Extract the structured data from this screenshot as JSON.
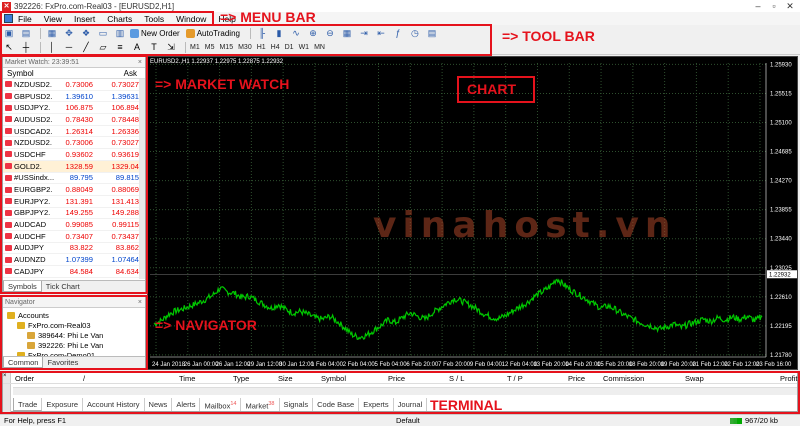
{
  "window": {
    "title": "392226: FxPro.com-Real03 - [EURUSD2,H1]",
    "controls": [
      "–",
      "▫",
      "✕"
    ]
  },
  "menu": {
    "items": [
      "File",
      "View",
      "Insert",
      "Charts",
      "Tools",
      "Window",
      "Help"
    ]
  },
  "toolbar": {
    "new_order_label": "New Order",
    "autotrading_label": "AutoTrading",
    "timeframes": [
      "M1",
      "M5",
      "M15",
      "M30",
      "H1",
      "H4",
      "D1",
      "W1",
      "MN"
    ]
  },
  "market_watch": {
    "title": "Market Watch: 23:39:51",
    "col_symbol": "Symbol",
    "col_ask": "Ask",
    "rows": [
      {
        "symbol": "NZDUSD2.",
        "bid": "0.73006",
        "ask": "0.73027",
        "bid_color": "red",
        "ask_color": "red"
      },
      {
        "symbol": "GBPUSD2.",
        "bid": "1.39610",
        "ask": "1.39631",
        "bid_color": "blue",
        "ask_color": "blue"
      },
      {
        "symbol": "USDJPY2.",
        "bid": "106.875",
        "ask": "106.894",
        "bid_color": "red",
        "ask_color": "red"
      },
      {
        "symbol": "AUDUSD2.",
        "bid": "0.78430",
        "ask": "0.78448",
        "bid_color": "red",
        "ask_color": "red"
      },
      {
        "symbol": "USDCAD2.",
        "bid": "1.26314",
        "ask": "1.26336",
        "bid_color": "red",
        "ask_color": "red"
      },
      {
        "symbol": "NZDUSD2.",
        "bid": "0.73006",
        "ask": "0.73027",
        "bid_color": "red",
        "ask_color": "red"
      },
      {
        "symbol": "USDCHF",
        "bid": "0.93602",
        "ask": "0.93619",
        "bid_color": "red",
        "ask_color": "red"
      },
      {
        "symbol": "GOLD2.",
        "bid": "1328.59",
        "ask": "1329.04",
        "bid_color": "red",
        "ask_color": "red",
        "highlight": true
      },
      {
        "symbol": "#USSindx...",
        "bid": "89.795",
        "ask": "89.815",
        "bid_color": "blue",
        "ask_color": "blue"
      },
      {
        "symbol": "EURGBP2.",
        "bid": "0.88049",
        "ask": "0.88069",
        "bid_color": "red",
        "ask_color": "red"
      },
      {
        "symbol": "EURJPY2.",
        "bid": "131.391",
        "ask": "131.413",
        "bid_color": "red",
        "ask_color": "red"
      },
      {
        "symbol": "GBPJPY2.",
        "bid": "149.255",
        "ask": "149.288",
        "bid_color": "red",
        "ask_color": "red"
      },
      {
        "symbol": "AUDCAD",
        "bid": "0.99085",
        "ask": "0.99115",
        "bid_color": "red",
        "ask_color": "red"
      },
      {
        "symbol": "AUDCHF",
        "bid": "0.73407",
        "ask": "0.73437",
        "bid_color": "red",
        "ask_color": "red"
      },
      {
        "symbol": "AUDJPY",
        "bid": "83.822",
        "ask": "83.862",
        "bid_color": "red",
        "ask_color": "red"
      },
      {
        "symbol": "AUDNZD",
        "bid": "1.07399",
        "ask": "1.07464",
        "bid_color": "blue",
        "ask_color": "blue"
      },
      {
        "symbol": "CADJPY",
        "bid": "84.584",
        "ask": "84.634",
        "bid_color": "red",
        "ask_color": "red"
      }
    ],
    "tabs": [
      "Symbols",
      "Tick Chart"
    ]
  },
  "navigator": {
    "title": "Navigator",
    "tree": [
      {
        "label": "Accounts",
        "level": 0
      },
      {
        "label": "FxPro.com-Real03",
        "level": 1
      },
      {
        "label": "389644: Phi Le Van",
        "level": 2
      },
      {
        "label": "392226: Phi Le Van",
        "level": 2
      },
      {
        "label": "FxPro.com-Demo01",
        "level": 1
      }
    ],
    "tabs": [
      "Common",
      "Favorites"
    ]
  },
  "chart": {
    "header": "EURUSD2.,H1  1.22937 1.22975 1.22875 1.22932",
    "current_price": "1.22932",
    "grid_color": "#2e4f2e",
    "line_color": "#00c800"
  },
  "chart_data": {
    "type": "line",
    "title": "EURUSD2.,H1",
    "series": [
      {
        "name": "EURUSD2.",
        "values": [
          1.2225,
          1.2232,
          1.2228,
          1.2238,
          1.2247,
          1.2243,
          1.2256,
          1.2254,
          1.2262,
          1.2258,
          1.2268,
          1.2273,
          1.2266,
          1.226,
          1.225,
          1.2242,
          1.2236,
          1.224,
          1.2231,
          1.2233,
          1.2222,
          1.2214,
          1.2205,
          1.2213,
          1.2225,
          1.222,
          1.2232,
          1.224,
          1.2233,
          1.2246,
          1.2256,
          1.2262,
          1.2252,
          1.2249,
          1.2243,
          1.2232,
          1.2238,
          1.2244,
          1.2255,
          1.2251,
          1.2264,
          1.2274,
          1.2266,
          1.2256,
          1.2247,
          1.224,
          1.2232,
          1.2227,
          1.2222,
          1.2218,
          1.2222,
          1.2229,
          1.2226,
          1.2236,
          1.2233,
          1.2222,
          1.2216,
          1.2214,
          1.2228,
          1.2235,
          1.223,
          1.2242,
          1.2248,
          1.2256,
          1.2252,
          1.2262,
          1.2266,
          1.226,
          1.2256,
          1.2252,
          1.225,
          1.2246,
          1.2234,
          1.2237,
          1.223,
          1.2227,
          1.2231,
          1.2223,
          1.2227,
          1.222,
          1.2223,
          1.2227,
          1.223,
          1.2232
        ]
      }
    ],
    "y_tick_labels": [
      "1.25930",
      "1.25515",
      "1.25100",
      "1.24685",
      "1.24270",
      "1.23855",
      "1.23440",
      "1.23025",
      "1.22610",
      "1.22195",
      "1.21780"
    ],
    "x_tick_labels": [
      "24 Jan 2018",
      "26 Jan 00:00",
      "26 Jan 12:00",
      "29 Jan 12:00",
      "30 Jan 12:00",
      "1 Feb 04:00",
      "2 Feb 04:00",
      "5 Feb 04:00",
      "6 Feb 20:00",
      "7 Feb 20:00",
      "9 Feb 04:00",
      "12 Feb 04:00",
      "13 Feb 20:00",
      "14 Feb 20:00",
      "15 Feb 20:00",
      "18 Feb 20:00",
      "19 Feb 20:00",
      "21 Feb 12:00",
      "22 Feb 12:00",
      "23 Feb 16:00"
    ],
    "ylim": [
      1.2175,
      1.2595
    ],
    "grid": true,
    "values": [
      1.2222,
      1.2227,
      1.2236,
      1.2241,
      1.2244,
      1.2248,
      1.2252,
      1.2257,
      1.2263,
      1.2273,
      1.2268,
      1.2266,
      1.226,
      1.2262,
      1.2256,
      1.225,
      1.2245,
      1.225,
      1.2243,
      1.2238,
      1.224,
      1.2236,
      1.2231,
      1.2229,
      1.2233,
      1.2226,
      1.2217,
      1.2207,
      1.2203,
      1.2206,
      1.2213,
      1.222,
      1.2228,
      1.2224,
      1.2232,
      1.2238,
      1.2233,
      1.2229,
      1.2238,
      1.2245,
      1.2252,
      1.2258,
      1.2255,
      1.225,
      1.2244,
      1.2237,
      1.2232,
      1.223,
      1.2234,
      1.2241,
      1.2247,
      1.2253,
      1.2262,
      1.2268,
      1.2275,
      1.2287,
      1.2278,
      1.227,
      1.2264,
      1.2258,
      1.2251,
      1.2245,
      1.2248,
      1.2243,
      1.2236,
      1.2231,
      1.2226,
      1.2222,
      1.2219,
      1.2215,
      1.2218,
      1.2222,
      1.2217,
      1.2222,
      1.2225,
      1.2229,
      1.2226,
      1.2231,
      1.2228,
      1.2232,
      1.2229,
      1.2233,
      1.2227,
      1.2232
    ]
  },
  "terminal": {
    "columns": [
      "Order",
      "/",
      "Time",
      "Type",
      "Size",
      "Symbol",
      "Price",
      "S / L",
      "T / P",
      "Price",
      "Commission",
      "Swap",
      "Profit"
    ],
    "tabs": [
      {
        "label": "Trade"
      },
      {
        "label": "Exposure"
      },
      {
        "label": "Account History"
      },
      {
        "label": "News"
      },
      {
        "label": "Alerts"
      },
      {
        "label": "Mailbox",
        "badge": "14"
      },
      {
        "label": "Market",
        "badge": "38"
      },
      {
        "label": "Signals"
      },
      {
        "label": "Code Base"
      },
      {
        "label": "Experts"
      },
      {
        "label": "Journal"
      }
    ]
  },
  "statusbar": {
    "help": "For Help, press F1",
    "profile": "Default",
    "traffic": "967/20 kb"
  },
  "annotations": {
    "menu_bar": "=> MENU BAR",
    "tool_bar": "=> TOOL BAR",
    "market_watch": "=> MARKET WATCH",
    "chart": "CHART",
    "navigator": "=> NAVIGATOR",
    "terminal": "TERMINAL",
    "watermark": "vinahost.vn",
    "color": "#e5121c"
  }
}
